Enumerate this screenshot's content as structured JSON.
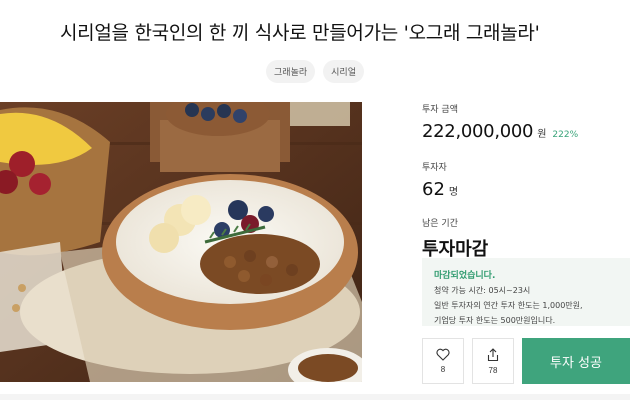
{
  "header": {
    "title": "시리얼을 한국인의 한 끼 식사로 만들어가는 '오그래 그래놀라'",
    "tags": [
      "그래놀라",
      "시리얼"
    ]
  },
  "photo": {
    "subject": "granola-yogurt-bowl"
  },
  "funding": {
    "amount_label": "투자 금액",
    "amount": "222,000,000",
    "amount_unit": "원",
    "percent": "222%",
    "investors_label": "투자자",
    "investors": "62",
    "investors_unit": "명",
    "remaining_label": "남은 기간",
    "status": "투자마감"
  },
  "notice": {
    "title": "마감되었습니다.",
    "lines": [
      "청약 가능 시간: 05시~23시",
      "일반 투자자의 연간 투자 한도는 1,000만원,",
      "기업당 투자 한도는 500만원입니다."
    ]
  },
  "actions": {
    "like_count": "8",
    "share_count": "78",
    "invest_label": "투자 성공"
  },
  "colors": {
    "accent": "#3fa47d",
    "percent": "#3aa47a",
    "notice_bg": "#f2f6f3"
  },
  "icons": [
    "heart-icon",
    "share-icon"
  ]
}
